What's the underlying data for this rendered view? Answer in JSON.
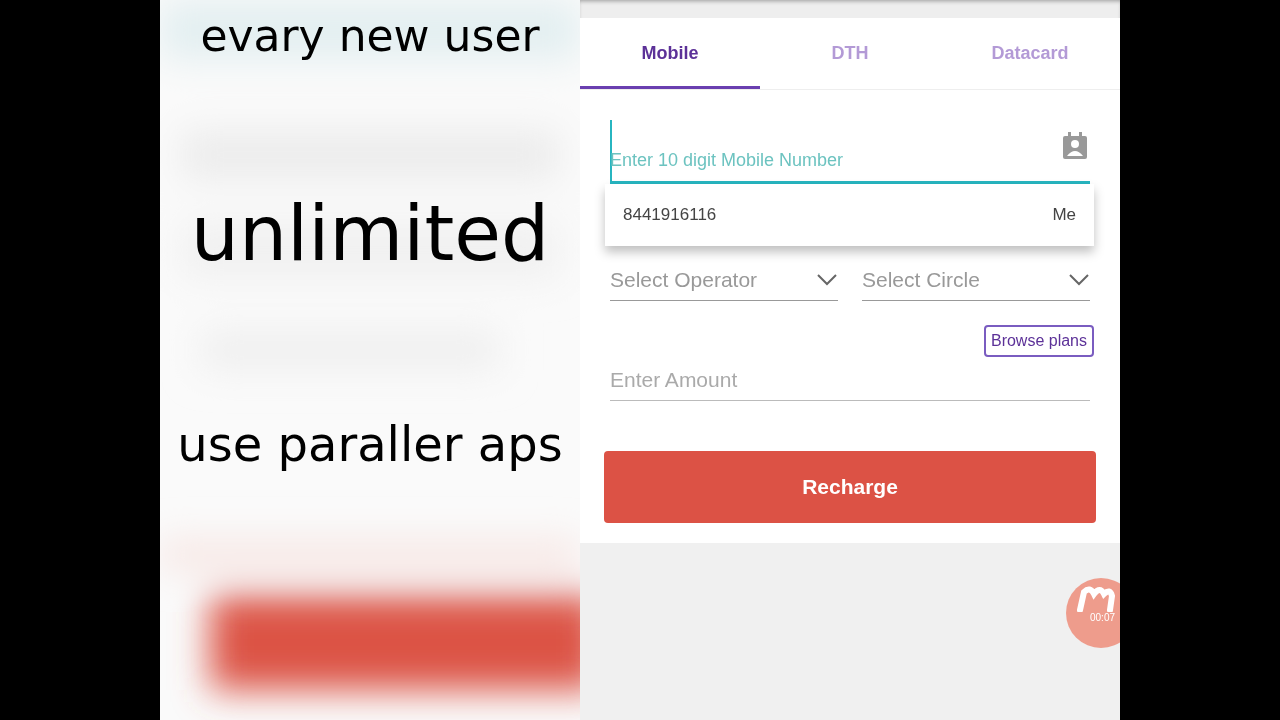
{
  "captions": [
    "evary new user",
    "unlimited",
    "use paraller aps"
  ],
  "tabs": [
    {
      "label": "Mobile",
      "selected": true
    },
    {
      "label": "DTH",
      "selected": false
    },
    {
      "label": "Datacard",
      "selected": false
    }
  ],
  "mobile_field": {
    "placeholder": "Enter 10 digit Mobile Number",
    "focused": true
  },
  "suggestion": {
    "number": "8441916116",
    "name": "Me"
  },
  "selects": [
    "Select Operator",
    "Select Circle"
  ],
  "amount_field": {
    "placeholder": "Enter Amount"
  },
  "browse_button": "Browse plans",
  "recharge_button": "Recharge",
  "recorder": {
    "time": "00:07"
  }
}
